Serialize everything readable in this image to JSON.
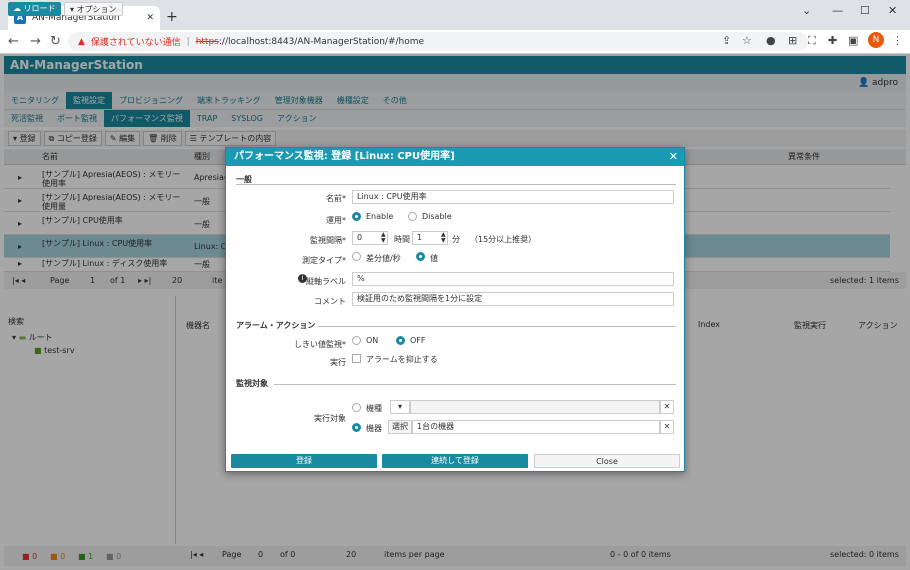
{
  "browser": {
    "tab_title": "AN-ManagerStation",
    "new_tab": "+",
    "security_warning": "保護されていない通信",
    "url_scheme": "https",
    "url_rest": "://localhost:8443/AN-ManagerStation/#/home",
    "avatar_letter": "N"
  },
  "app": {
    "title": "AN-ManagerStation",
    "reload": "リロード",
    "options": "オプション",
    "user": "adpro",
    "nav1": [
      "モニタリング",
      "監視設定",
      "プロビジョニング",
      "端末トラッキング",
      "管理対象機器",
      "機種設定",
      "その他"
    ],
    "nav2": [
      "死活監視",
      "ポート監視",
      "パフォーマンス監視",
      "TRAP",
      "SYSLOG",
      "アクション"
    ],
    "grid_toolbar": [
      "登録",
      "コピー登録",
      "編集",
      "削除",
      "テンプレートの内容"
    ],
    "grid_headers": {
      "name": "名前",
      "type": "種別",
      "abnormal": "異常条件"
    },
    "rows": [
      {
        "name": "[サンプル] Apresia(AEOS) : メモリー使用率",
        "type": "Apresia(A"
      },
      {
        "name": "[サンプル] Apresia(AEOS) : メモリー使用量",
        "type": "一般"
      },
      {
        "name": "[サンプル] CPU使用率",
        "type": "一般"
      },
      {
        "name": "[サンプル] Linux : CPU使用率",
        "type": "Linux: CPU"
      },
      {
        "name": "[サンプル] Linux : ディスク使用率",
        "type": "一般"
      }
    ],
    "pager1": {
      "page_label": "Page",
      "page": "1",
      "of": "of 1",
      "size": "20",
      "items": "ite",
      "selected": "selected: 1 items"
    },
    "tree": {
      "search": "検索",
      "root": "ルート",
      "child": "test-srv"
    },
    "lower_headers": {
      "device": "機器名",
      "index": "Index",
      "monitor": "監視実行",
      "action": "アクション"
    },
    "pager2": {
      "page_label": "Page",
      "page": "0",
      "of": "of 0",
      "size": "20",
      "items": "items per page",
      "range": "0 - 0 of 0 items",
      "selected": "selected: 0 items"
    },
    "status_counts": [
      "0",
      "0",
      "1",
      "0"
    ]
  },
  "dialog": {
    "title": "パフォーマンス監視: 登録 [Linux: CPU使用率]",
    "section_general": "一般",
    "name_label": "名前*",
    "name_value": "Linux : CPU使用率",
    "operation_label": "運用*",
    "enable": "Enable",
    "disable": "Disable",
    "interval_label": "監視間隔*",
    "interval_hours": "0",
    "hours_unit": "時間",
    "interval_minutes": "1",
    "minutes_unit": "分",
    "interval_note": "（15分以上推奨）",
    "measure_label": "測定タイプ*",
    "measure_diff": "差分値/秒",
    "measure_value": "値",
    "axis_label": "縦軸ラベル",
    "axis_value": "%",
    "comment_label": "コメント",
    "comment_value": "検証用のため監視間隔を1分に設定",
    "section_alarm": "アラーム・アクション",
    "threshold_label": "しきい値監視*",
    "on": "ON",
    "off": "OFF",
    "exec_label": "実行",
    "suppress": "アラームを抑止する",
    "section_target": "監視対象",
    "target_label": "実行対象",
    "target_model": "機種",
    "target_device": "機器",
    "select_btn": "選択",
    "device_value": "1台の機器",
    "btn_register": "登録",
    "btn_continue": "連続して登録",
    "btn_close": "Close"
  }
}
